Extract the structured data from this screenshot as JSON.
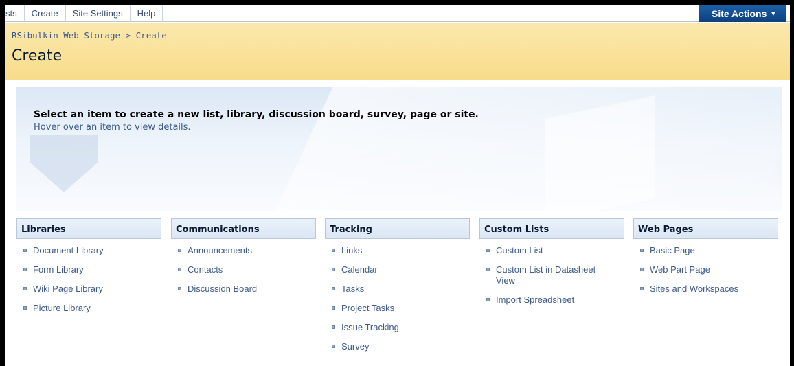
{
  "topnav": {
    "items": [
      "sts",
      "Create",
      "Site Settings",
      "Help"
    ],
    "site_actions": "Site Actions"
  },
  "breadcrumb": {
    "site": "RSibulkin Web Storage",
    "separator": ">",
    "current": "Create"
  },
  "page_title": "Create",
  "banner": {
    "heading": "Select an item to create a new list, library, discussion board, survey, page or site.",
    "subtext": "Hover over an item to view details."
  },
  "categories": [
    {
      "title": "Libraries",
      "items": [
        "Document Library",
        "Form Library",
        "Wiki Page Library",
        "Picture Library"
      ]
    },
    {
      "title": "Communications",
      "items": [
        "Announcements",
        "Contacts",
        "Discussion Board"
      ]
    },
    {
      "title": "Tracking",
      "items": [
        "Links",
        "Calendar",
        "Tasks",
        "Project Tasks",
        "Issue Tracking",
        "Survey"
      ]
    },
    {
      "title": "Custom Lists",
      "items": [
        "Custom List",
        "Custom List in Datasheet View",
        "Import Spreadsheet"
      ]
    },
    {
      "title": "Web Pages",
      "items": [
        "Basic Page",
        "Web Part Page",
        "Sites and Workspaces"
      ]
    }
  ],
  "colors": {
    "link": "#3f5b8c",
    "title_band": "#f8dc8a",
    "site_actions": "#0d3f7c"
  }
}
